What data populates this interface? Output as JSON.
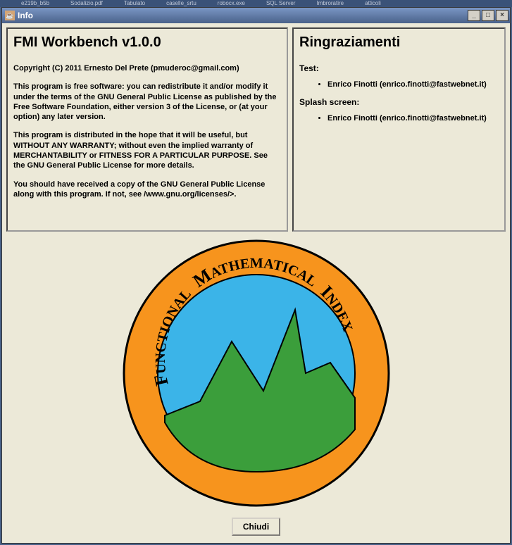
{
  "taskbar": {
    "items": [
      "e219b_b5b",
      "Sodalizio.pdf",
      "Tabulato",
      "caselle_srtu",
      "robocx.exe",
      "SQL Server",
      "Imbroratire",
      "atticoli"
    ]
  },
  "window": {
    "title": "Info"
  },
  "left_panel": {
    "heading": "FMI Workbench v1.0.0",
    "copyright": "Copyright (C) 2011 Ernesto Del Prete (pmuderoc@gmail.com)",
    "para1": "This program is free software: you can redistribute it and/or modify it under the terms of the GNU General Public License as published by the Free Software Foundation, either version 3 of the License, or (at your option) any later version.",
    "para2": "This program is distributed in the hope that it will be useful, but WITHOUT ANY WARRANTY; without even the implied warranty of MERCHANTABILITY or FITNESS FOR A PARTICULAR PURPOSE. See the GNU General Public License for more details.",
    "para3": "You should have received a copy of the GNU General Public License along with this program. If not, see /www.gnu.org/licenses/>."
  },
  "right_panel": {
    "heading": "Ringraziamenti",
    "test_label": "Test:",
    "test_person": "Enrico Finotti (enrico.finotti@fastwebnet.it)",
    "splash_label": "Splash screen:",
    "splash_person": "Enrico Finotti (enrico.finotti@fastwebnet.it)"
  },
  "logo": {
    "text_top": "FUNCTIONAL MATHEMATICAL INDEX"
  },
  "buttons": {
    "close": "Chiudi"
  }
}
